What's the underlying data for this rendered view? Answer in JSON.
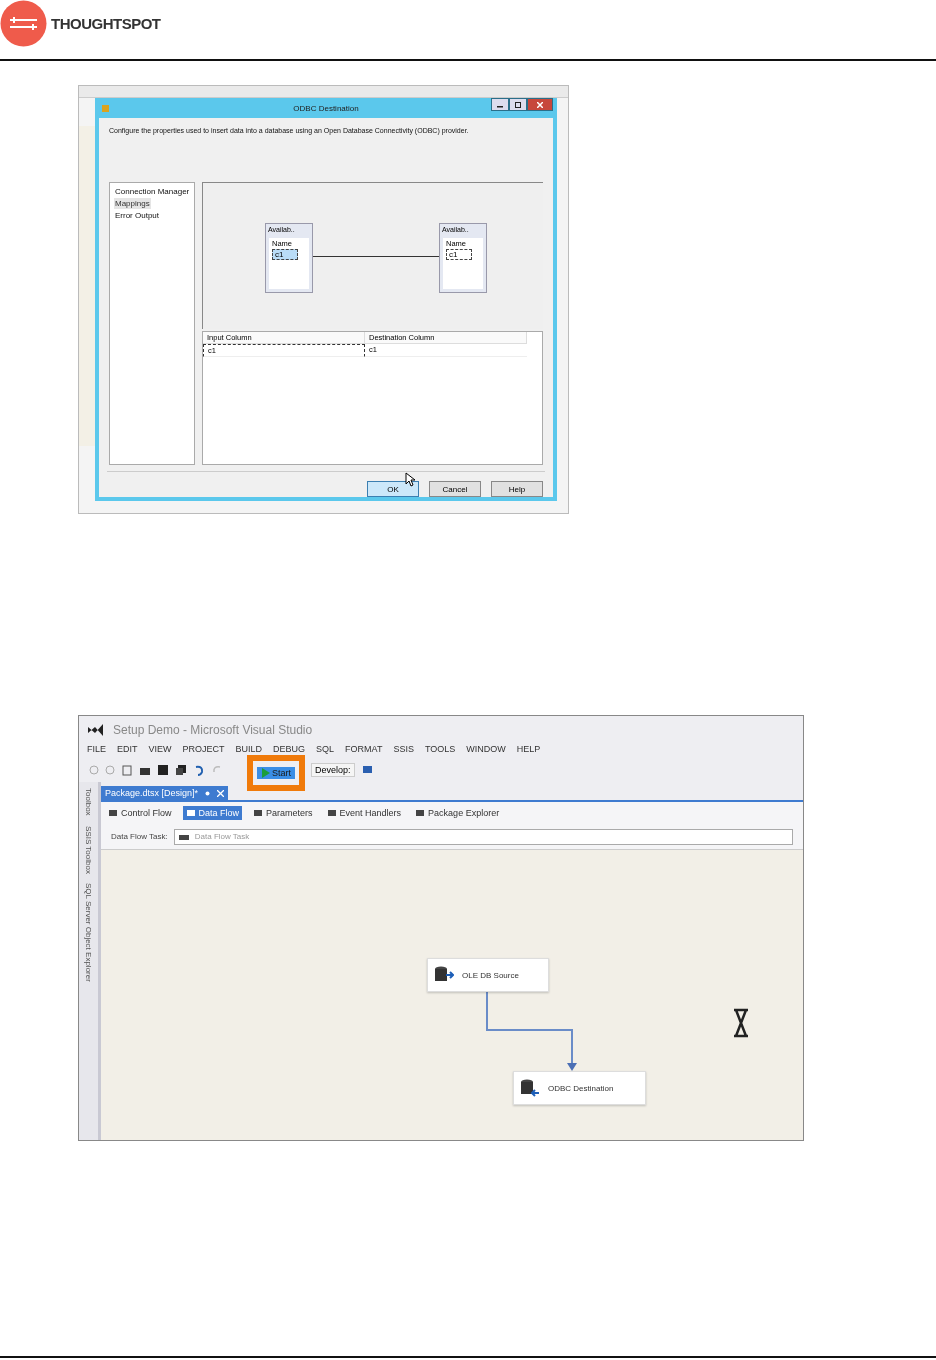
{
  "header": {
    "brand": "THOUGHTSPOT"
  },
  "dialog_screenshot": {
    "dialog": {
      "title": "ODBC Destination",
      "description": "Configure the properties used to insert data into a database using an Open Database Connectivity (ODBC) provider.",
      "nav_items": [
        {
          "label": "Connection Manager",
          "selected": false
        },
        {
          "label": "Mappings",
          "selected": true
        },
        {
          "label": "Error Output",
          "selected": false
        }
      ],
      "column_tables": [
        {
          "title": "Availab..",
          "column": "Name",
          "items": [
            {
              "label": "c1",
              "selected": true
            }
          ]
        },
        {
          "title": "Availab..",
          "column": "Name",
          "items": [
            {
              "label": "c1",
              "selected": false
            }
          ]
        }
      ],
      "mapping": {
        "columns": [
          "Input Column",
          "Destination Column"
        ],
        "rows": [
          [
            "c1",
            "c1"
          ]
        ]
      },
      "buttons": [
        {
          "label": "OK",
          "default": true
        },
        {
          "label": "Cancel",
          "default": false
        },
        {
          "label": "Help",
          "default": false
        }
      ]
    }
  },
  "vs_screenshot": {
    "title": "Setup Demo - Microsoft Visual Studio",
    "menu": [
      "FILE",
      "EDIT",
      "VIEW",
      "PROJECT",
      "BUILD",
      "DEBUG",
      "SQL",
      "FORMAT",
      "SSIS",
      "TOOLS",
      "WINDOW",
      "HELP"
    ],
    "toolbar": {
      "start": {
        "label": "Start",
        "highlighted": true
      },
      "configuration": "Develop:"
    },
    "side_tabs": [
      "Toolbox",
      "SSIS Toolbox",
      "SQL Server Object Explorer"
    ],
    "document_tab": "Package.dtsx [Design]*",
    "designer_tabs": [
      {
        "label": "Control Flow",
        "selected": false
      },
      {
        "label": "Data Flow",
        "selected": true
      },
      {
        "label": "Parameters",
        "selected": false
      },
      {
        "label": "Event Handlers",
        "selected": false
      },
      {
        "label": "Package Explorer",
        "selected": false
      }
    ],
    "task": {
      "label": "Data Flow Task:",
      "value": "Data Flow Task"
    },
    "nodes": [
      {
        "kind": "source",
        "label": "OLE DB Source"
      },
      {
        "kind": "destination",
        "label": "ODBC Destination"
      }
    ],
    "busy": true
  }
}
